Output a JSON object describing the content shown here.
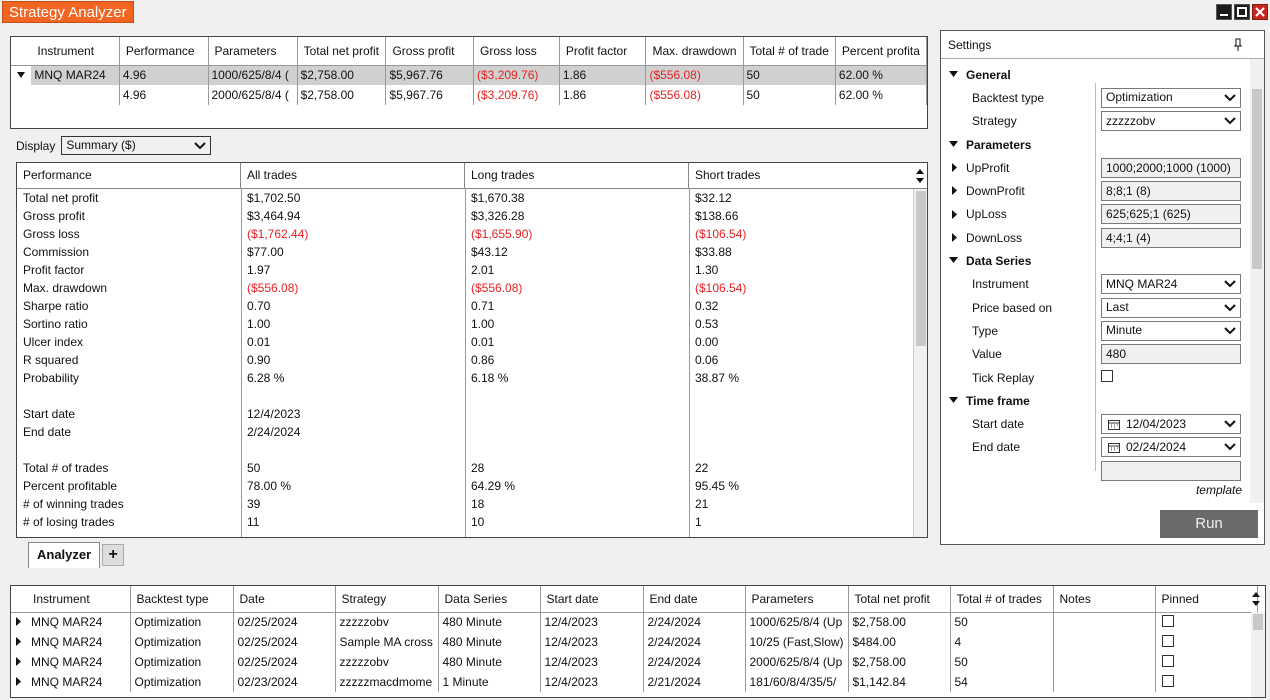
{
  "window": {
    "title": "Strategy Analyzer"
  },
  "top_grid": {
    "columns": [
      "Instrument",
      "Performance",
      "Parameters",
      "Total net profit",
      "Gross profit",
      "Gross loss",
      "Profit factor",
      "Max. drawdown",
      "Total # of trade",
      "Percent profita"
    ],
    "rows": [
      [
        "MNQ MAR24",
        "4.96",
        "1000/625/8/4 (",
        "$2,758.00",
        "$5,967.76",
        "($3,209.76)",
        "1.86",
        "($556.08)",
        "50",
        "62.00 %"
      ],
      [
        "",
        "4.96",
        "2000/625/8/4 (",
        "$2,758.00",
        "$5,967.76",
        "($3,209.76)",
        "1.86",
        "($556.08)",
        "50",
        "62.00 %"
      ]
    ]
  },
  "display": {
    "label": "Display",
    "value": "Summary ($)"
  },
  "performance": {
    "columns": [
      "Performance",
      "All trades",
      "Long trades",
      "Short trades"
    ],
    "rows": [
      [
        "Total net profit",
        "$1,702.50",
        "$1,670.38",
        "$32.12"
      ],
      [
        "Gross profit",
        "$3,464.94",
        "$3,326.28",
        "$138.66"
      ],
      [
        "Gross loss",
        "($1,762.44)",
        "($1,655.90)",
        "($106.54)"
      ],
      [
        "Commission",
        "$77.00",
        "$43.12",
        "$33.88"
      ],
      [
        "Profit factor",
        "1.97",
        "2.01",
        "1.30"
      ],
      [
        "Max. drawdown",
        "($556.08)",
        "($556.08)",
        "($106.54)"
      ],
      [
        "Sharpe ratio",
        "0.70",
        "0.71",
        "0.32"
      ],
      [
        "Sortino ratio",
        "1.00",
        "1.00",
        "0.53"
      ],
      [
        "Ulcer index",
        "0.01",
        "0.01",
        "0.00"
      ],
      [
        "R squared",
        "0.90",
        "0.86",
        "0.06"
      ],
      [
        "Probability",
        "6.28 %",
        "6.18 %",
        "38.87 %"
      ],
      [
        "",
        "",
        "",
        ""
      ],
      [
        "Start date",
        "12/4/2023",
        "",
        ""
      ],
      [
        "End date",
        "2/24/2024",
        "",
        ""
      ],
      [
        "",
        "",
        "",
        ""
      ],
      [
        "Total # of trades",
        "50",
        "28",
        "22"
      ],
      [
        "Percent profitable",
        "78.00 %",
        "64.29 %",
        "95.45 %"
      ],
      [
        "# of winning trades",
        "39",
        "18",
        "21"
      ],
      [
        "# of losing trades",
        "11",
        "10",
        "1"
      ]
    ]
  },
  "settings": {
    "title": "Settings",
    "general": "General",
    "backtest_type_label": "Backtest type",
    "backtest_type": "Optimization",
    "strategy_label": "Strategy",
    "strategy": "zzzzzobv",
    "parameters": "Parameters",
    "upprofit_label": "UpProfit",
    "upprofit": "1000;2000;1000 (1000)",
    "downprofit_label": "DownProfit",
    "downprofit": "8;8;1 (8)",
    "uploss_label": "UpLoss",
    "uploss": "625;625;1 (625)",
    "downloss_label": "DownLoss",
    "downloss": "4;4;1 (4)",
    "data_series": "Data Series",
    "instrument_label": "Instrument",
    "instrument": "MNQ MAR24",
    "price_based_label": "Price based on",
    "price_based": "Last",
    "type_label": "Type",
    "type": "Minute",
    "value_label": "Value",
    "value": "480",
    "tick_replay_label": "Tick Replay",
    "time_frame": "Time frame",
    "start_date_label": "Start date",
    "start_date": "12/04/2023",
    "end_date_label": "End date",
    "end_date": "02/24/2024",
    "template": "template",
    "run": "Run"
  },
  "tabs": {
    "active": "Analyzer",
    "add": "+"
  },
  "bottom_grid": {
    "columns": [
      "Instrument",
      "Backtest type",
      "Date",
      "Strategy",
      "Data Series",
      "Start date",
      "End date",
      "Parameters",
      "Total net profit",
      "Total # of trades",
      "Notes",
      "Pinned"
    ],
    "rows": [
      [
        "MNQ MAR24",
        "Optimization",
        "02/25/2024",
        "zzzzzobv",
        "480 Minute",
        "12/4/2023",
        "2/24/2024",
        "1000/625/8/4 (Up",
        "$2,758.00",
        "50",
        ""
      ],
      [
        "MNQ MAR24",
        "Optimization",
        "02/25/2024",
        "Sample MA cross",
        "480 Minute",
        "12/4/2023",
        "2/24/2024",
        "10/25 (Fast,Slow)",
        "$484.00",
        "4",
        ""
      ],
      [
        "MNQ MAR24",
        "Optimization",
        "02/25/2024",
        "zzzzzobv",
        "480 Minute",
        "12/4/2023",
        "2/24/2024",
        "2000/625/8/4 (Up",
        "$2,758.00",
        "50",
        ""
      ],
      [
        "MNQ MAR24",
        "Optimization",
        "02/23/2024",
        "zzzzzmacdmome",
        "1 Minute",
        "12/4/2023",
        "2/21/2024",
        "181/60/8/4/35/5/",
        "$1,142.84",
        "54",
        ""
      ]
    ]
  },
  "colors": {
    "accent": "#f26522",
    "negative": "#e32222",
    "run_button": "#6b6b6b"
  }
}
